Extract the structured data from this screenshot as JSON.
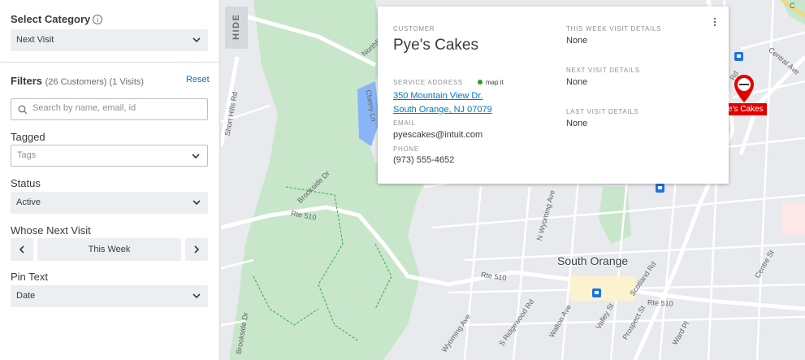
{
  "sidebar": {
    "select_category": {
      "label": "Select Category",
      "info_icon": "info-icon",
      "value": "Next Visit"
    },
    "filters": {
      "label": "Filters",
      "counts": "(26 Customers) (1 Visits)",
      "reset": "Reset"
    },
    "search": {
      "placeholder": "Search by name, email, id"
    },
    "tagged": {
      "label": "Tagged",
      "placeholder": "Tags"
    },
    "status": {
      "label": "Status",
      "value": "Active"
    },
    "whose_next_visit": {
      "label": "Whose Next Visit",
      "value": "This Week",
      "prev_icon": "chevron-left-icon",
      "next_icon": "chevron-right-icon"
    },
    "pin_text": {
      "label": "Pin Text",
      "value": "Date"
    },
    "hide_tab": "HIDE"
  },
  "card": {
    "customer_label": "CUSTOMER",
    "customer_name": "Pye's Cakes",
    "service_address_label": "SERVICE ADDRESS",
    "map_it": "map it",
    "address_line1": "350 Mountain View Dr.",
    "address_line2": "South Orange, NJ 07079",
    "email_label": "EMAIL",
    "email": "pyescakes@intuit.com",
    "phone_label": "PHONE",
    "phone": "(973) 555-4652",
    "this_week_label": "THIS WEEK VISIT DETAILS",
    "this_week_value": "None",
    "next_visit_label": "NEXT VISIT DETAILS",
    "next_visit_value": "None",
    "last_visit_label": "LAST VISIT DETAILS",
    "last_visit_value": "None"
  },
  "map": {
    "pin_label": "ye's Cakes",
    "town": "South Orange",
    "roads": [
      "Northfield",
      "Cherry Ln",
      "Brookside Dr",
      "Rte 510",
      "Rte 510",
      "Rte 510",
      "N Wyoming Ave",
      "Wyoming Ave",
      "S Ridgewood Rd",
      "Walton Ave",
      "Valley St",
      "Scotland Rd",
      "Prospect St",
      "Ward Pl",
      "Centre St",
      "Central Ave",
      "Rd",
      "Rd",
      "Short Hills Rd",
      "Brookside Dr",
      "C"
    ],
    "colors": {
      "park": "#c8e6c9",
      "water": "#8ab4f8",
      "road": "#ffffff",
      "pin": "#e50000"
    }
  }
}
